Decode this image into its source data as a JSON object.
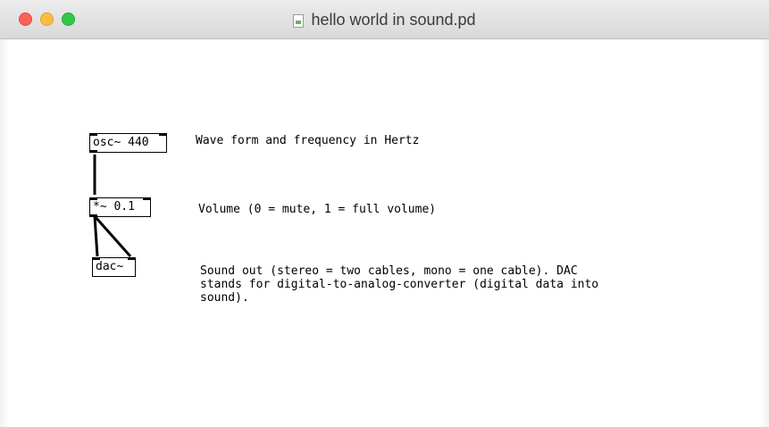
{
  "window": {
    "title": "hello world in sound.pd",
    "title_icon": "pd-document-icon"
  },
  "patch": {
    "objects": [
      {
        "id": "osc",
        "text": "osc~ 440"
      },
      {
        "id": "mul",
        "text": "*~ 0.1"
      },
      {
        "id": "dac",
        "text": "dac~"
      }
    ],
    "comments": [
      {
        "id": "osc-comment",
        "text": "Wave form and frequency in Hertz"
      },
      {
        "id": "mul-comment",
        "text": "Volume (0 = mute, 1 = full volume)"
      },
      {
        "id": "dac-comment-1",
        "text": "Sound out (stereo = two cables, mono = one cable). DAC"
      },
      {
        "id": "dac-comment-2",
        "text": "stands for digital-to-analog-converter (digital data into"
      },
      {
        "id": "dac-comment-3",
        "text": "sound)."
      }
    ]
  },
  "colors": {
    "close": "#fc605c",
    "minimize": "#fdbc40",
    "maximize": "#34c84a",
    "cord": "#000000"
  }
}
